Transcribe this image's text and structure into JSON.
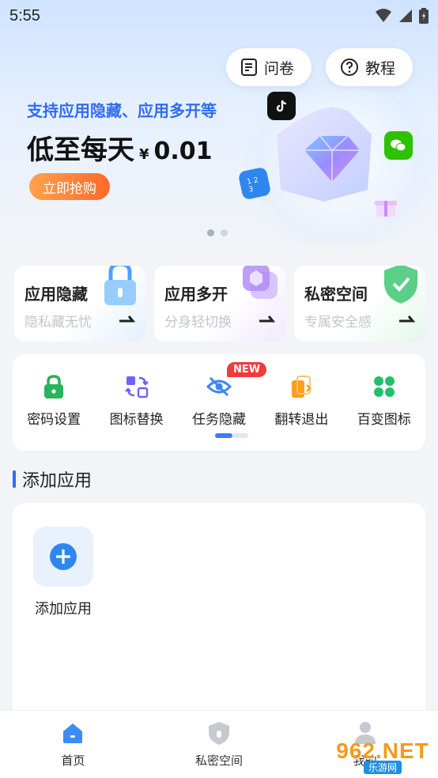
{
  "status": {
    "time": "5:55"
  },
  "header": {
    "survey_label": "问卷",
    "tutorial_label": "教程"
  },
  "promo": {
    "title": "支持应用隐藏、应用多开等",
    "price_prefix": "低至每天",
    "currency": "¥",
    "price": "0.01",
    "buy_label": "立即抢购"
  },
  "features": [
    {
      "title": "应用隐藏",
      "subtitle": "隐私藏无忧"
    },
    {
      "title": "应用多开",
      "subtitle": "分身轻切换"
    },
    {
      "title": "私密空间",
      "subtitle": "专属安全感"
    }
  ],
  "tools": [
    {
      "label": "密码设置",
      "icon": "lock-icon"
    },
    {
      "label": "图标替换",
      "icon": "swap-icon"
    },
    {
      "label": "任务隐藏",
      "icon": "eye-off-icon",
      "badge": "NEW"
    },
    {
      "label": "翻转退出",
      "icon": "flip-icon"
    },
    {
      "label": "百变图标",
      "icon": "clover-icon"
    }
  ],
  "section": {
    "title": "添加应用"
  },
  "apps": {
    "add_label": "添加应用"
  },
  "nav": [
    {
      "label": "首页",
      "icon": "home-icon"
    },
    {
      "label": "私密空间",
      "icon": "shield-icon"
    },
    {
      "label": "我的",
      "icon": "user-icon"
    }
  ],
  "watermark": {
    "logo": "962.NET",
    "sub": "乐游网"
  },
  "colors": {
    "accent": "#2f6cf0",
    "promo_button": "#ff7a33",
    "badge_new": "#ef3b3b"
  }
}
